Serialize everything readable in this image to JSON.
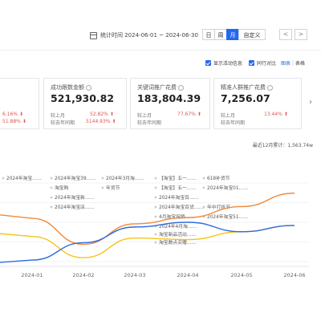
{
  "toolbar": {
    "date_label": "统计时间 2024-06-01 ~ 2024-06-30",
    "granularity": [
      "日",
      "周",
      "月",
      "自定义"
    ],
    "active_granularity": "月",
    "prev": "<",
    "next": ">"
  },
  "options": {
    "show_events": "显示活动信息",
    "compare_same_period": "同行对比",
    "view_chart": "图表",
    "view_table": "表格"
  },
  "cards": [
    {
      "id": "partial",
      "title": "",
      "value": "",
      "mom_pct": "6.16%",
      "yoy_pct": "51.88%",
      "mom_dir": "down",
      "yoy_dir": "down"
    },
    {
      "id": "deal-orders",
      "title": "成功跟数金额",
      "value": "521,930.82",
      "mom_label": "较上月",
      "yoy_label": "较去年同期",
      "mom_pct": "52.82%",
      "yoy_pct": "5144.93%",
      "mom_dir": "up",
      "yoy_dir": "up"
    },
    {
      "id": "keyword-spend",
      "title": "关键词推广花费",
      "value": "183,804.39",
      "mom_label": "较上月",
      "yoy_label": "较去年同期",
      "mom_pct": "77.67%",
      "mom_dir": "up"
    },
    {
      "id": "crowd-spend",
      "title": "精准人群推广花费",
      "value": "7,256.07",
      "mom_label": "较上月",
      "yoy_label": "较去年同期",
      "mom_pct": "13.44%",
      "mom_dir": "up"
    }
  ],
  "footnote": "最近12月累计：1,563.74w",
  "chart_data": {
    "type": "line",
    "x": [
      "2024-01",
      "2024-02",
      "2024-03",
      "2024-04",
      "2024-05",
      "2024-06"
    ],
    "series": [
      {
        "color": "#f08a3a",
        "values": [
          0.55,
          0.22,
          0.48,
          0.56,
          0.7,
          0.87
        ]
      },
      {
        "color": "#f5c518",
        "values": [
          0.32,
          0.05,
          0.3,
          0.28,
          0.38,
          0.46
        ]
      },
      {
        "color": "#2d6be0",
        "values": [
          0.02,
          0.24,
          0.44,
          0.5,
          0.38,
          0.46
        ]
      }
    ],
    "annotations": [
      {
        "label": "2024年淘宝……"
      },
      {
        "label": "2024年淘宝39……"
      },
      {
        "label": "2024年3月淘……"
      },
      {
        "label": "【淘宝】五一……"
      },
      {
        "label": "618补货节"
      },
      {
        "label": "淘宝购"
      },
      {
        "label": "年货节"
      },
      {
        "label": "【淘宝】五一……"
      },
      {
        "label": "2024年淘宝01……"
      },
      {
        "label": "2024年淘宝新……"
      },
      {
        "label": "2024年淘宝百……"
      },
      {
        "label": "2024年淘宝店……"
      },
      {
        "label": "年中打折节"
      },
      {
        "label": "2024年淘宝百货……"
      },
      {
        "label": "4月淘宝促销……"
      },
      {
        "label": "2024年淘宝51……"
      },
      {
        "label": "2024年4月淘……"
      },
      {
        "label": "淘宝新品活动……"
      },
      {
        "label": "淘宝数点买赠……"
      }
    ]
  }
}
